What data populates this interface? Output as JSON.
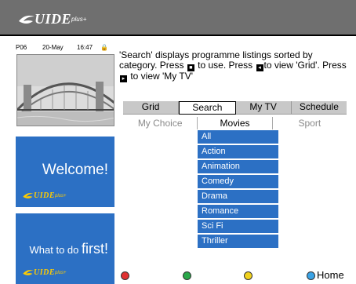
{
  "header": {
    "logo_text": "UIDE",
    "logo_plus": "plus+"
  },
  "channel": {
    "code": "P06",
    "date": "20-May",
    "time": "16:47",
    "lock_glyph": "🔒"
  },
  "promos": [
    {
      "text": "Welcome!",
      "logo_text": "UIDE",
      "logo_plus": "plus+"
    },
    {
      "text_pre": "What to do ",
      "text_big": "first!",
      "logo_text": "UIDE",
      "logo_plus": "plus+"
    }
  ],
  "instructions": {
    "line1": "'Search' displays programme listings sorted by category. Press ",
    "use_glyph": "■",
    "mid1": " to use. Press ",
    "grid_glyph": "◂",
    "mid2": "to view 'Grid'. Press",
    "mytv_glyph": "▸",
    "end": " to view 'My TV'"
  },
  "tabs": [
    "Grid",
    "Search",
    "My TV",
    "Schedule"
  ],
  "active_tab": "Search",
  "categories": [
    "My Choice",
    "Movies",
    "Sport"
  ],
  "active_category": "Movies",
  "genres": [
    "All",
    "Action",
    "Animation",
    "Comedy",
    "Drama",
    "Romance",
    "Sci Fi",
    "Thriller"
  ],
  "footer": {
    "home_label": "Home"
  },
  "colors": {
    "accent_blue": "#2c70c4",
    "header_gray": "#6f6f6f",
    "red": "#e03030",
    "green": "#2aa84a",
    "yellow": "#f1d21e",
    "blue": "#3aa3e6"
  }
}
